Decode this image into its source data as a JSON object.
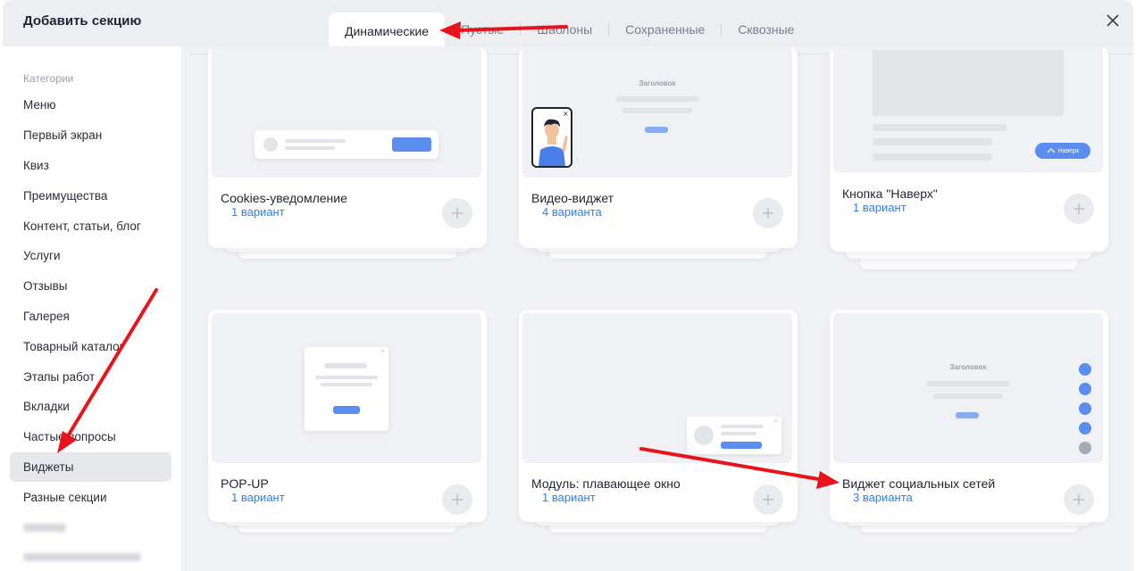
{
  "modal": {
    "title": "Добавить секцию"
  },
  "tabs": [
    {
      "label": "Динамические",
      "active": true
    },
    {
      "label": "Пустые"
    },
    {
      "label": "Шаблоны"
    },
    {
      "label": "Сохраненные"
    },
    {
      "label": "Сквозные"
    }
  ],
  "sidebar": {
    "heading": "Категории",
    "items": [
      {
        "label": "Меню"
      },
      {
        "label": "Первый экран"
      },
      {
        "label": "Квиз"
      },
      {
        "label": "Преимущества"
      },
      {
        "label": "Контент, статьи, блог"
      },
      {
        "label": "Услуги"
      },
      {
        "label": "Отзывы"
      },
      {
        "label": "Галерея"
      },
      {
        "label": "Товарный каталог"
      },
      {
        "label": "Этапы работ"
      },
      {
        "label": "Вкладки"
      },
      {
        "label": "Частые вопросы"
      },
      {
        "label": "Виджеты",
        "active": true
      },
      {
        "label": "Разные секции"
      }
    ]
  },
  "cards": [
    {
      "title": "Cookies-уведомление",
      "variants": "1 вариант"
    },
    {
      "title": "Видео-виджет",
      "variants": "4 варианта",
      "preview_heading": "Заголовок"
    },
    {
      "title": "Кнопка \"Наверх\"",
      "variants": "1 вариант",
      "preview_button": "Наверх"
    },
    {
      "title": "POP-UP",
      "variants": "1 вариант"
    },
    {
      "title": "Модуль: плавающее окно",
      "variants": "1 вариант"
    },
    {
      "title": "Виджет социальных сетей",
      "variants": "3 варианта",
      "preview_heading": "Заголовок"
    }
  ],
  "colors": {
    "accent": "#2d7ff0",
    "annotation_arrow": "#e8141c"
  }
}
